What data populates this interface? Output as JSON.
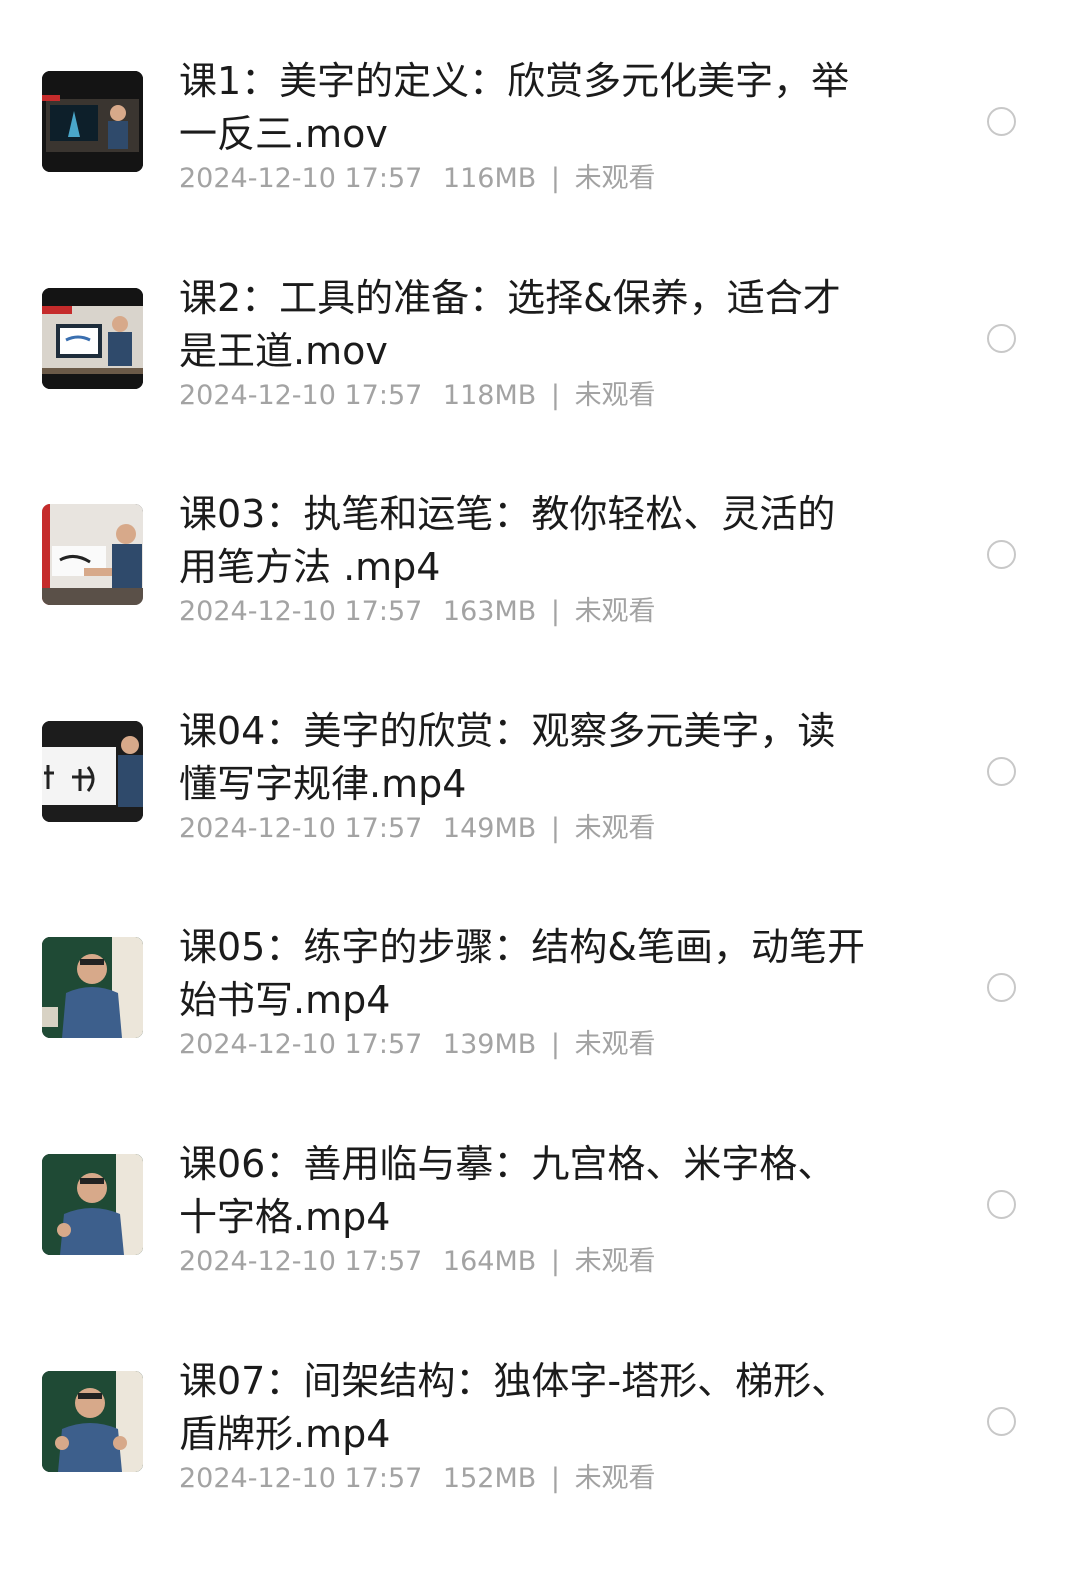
{
  "files": [
    {
      "title_line1": "课1：美字的定义：欣赏多元化美字，举",
      "title_line2": "一反三.mov",
      "date": "2024-12-10 17:57",
      "size": "116MB",
      "separator": "|",
      "status": "未观看",
      "thumb_icon": "video-thumbnail-icon"
    },
    {
      "title_line1": "课2：工具的准备：选择&保养，适合才",
      "title_line2": "是王道.mov",
      "date": "2024-12-10 17:57",
      "size": "118MB",
      "separator": "|",
      "status": "未观看",
      "thumb_icon": "video-thumbnail-icon"
    },
    {
      "title_line1": "课03：执笔和运笔：教你轻松、灵活的",
      "title_line2": "用笔方法 .mp4",
      "date": "2024-12-10 17:57",
      "size": "163MB",
      "separator": "|",
      "status": "未观看",
      "thumb_icon": "video-thumbnail-icon"
    },
    {
      "title_line1": "课04：美字的欣赏：观察多元美字，读",
      "title_line2": "懂写字规律.mp4",
      "date": "2024-12-10 17:57",
      "size": "149MB",
      "separator": "|",
      "status": "未观看",
      "thumb_icon": "video-thumbnail-icon"
    },
    {
      "title_line1": "课05：练字的步骤：结构&笔画，动笔开",
      "title_line2": "始书写.mp4",
      "date": "2024-12-10 17:57",
      "size": "139MB",
      "separator": "|",
      "status": "未观看",
      "thumb_icon": "video-thumbnail-icon"
    },
    {
      "title_line1": "课06：善用临与摹：九宫格、米字格、",
      "title_line2": "十字格.mp4",
      "date": "2024-12-10 17:57",
      "size": "164MB",
      "separator": "|",
      "status": "未观看",
      "thumb_icon": "video-thumbnail-icon"
    },
    {
      "title_line1": "课07：间架结构：独体字-塔形、梯形、",
      "title_line2": "盾牌形.mp4",
      "date": "2024-12-10 17:57",
      "size": "152MB",
      "separator": "|",
      "status": "未观看",
      "thumb_icon": "video-thumbnail-icon"
    }
  ],
  "colors": {
    "title_text": "#1b1b1b",
    "meta_text": "#a3a3a3",
    "radio_border": "#c8c8c8",
    "background": "#ffffff"
  }
}
